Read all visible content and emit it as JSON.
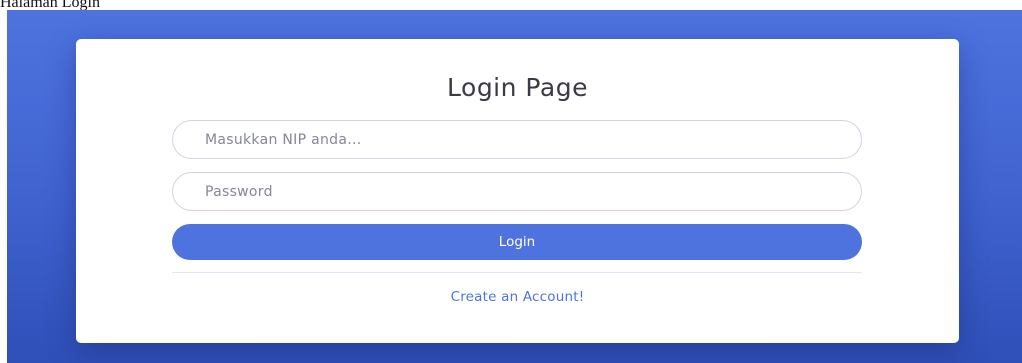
{
  "document": {
    "caption": "Halaman Login"
  },
  "login_card": {
    "title": "Login Page",
    "nip_placeholder": "Masukkan NIP anda...",
    "password_placeholder": "Password",
    "login_button_label": "Login",
    "create_account_link": "Create an Account!"
  },
  "colors": {
    "background_gradient_top": "#4e73df",
    "background_gradient_bottom": "#2f4fb8",
    "primary": "#4e73df",
    "card": "#ffffff",
    "title_text": "#3a3b45",
    "placeholder_text": "#858796",
    "input_border": "#d1d3e2"
  }
}
